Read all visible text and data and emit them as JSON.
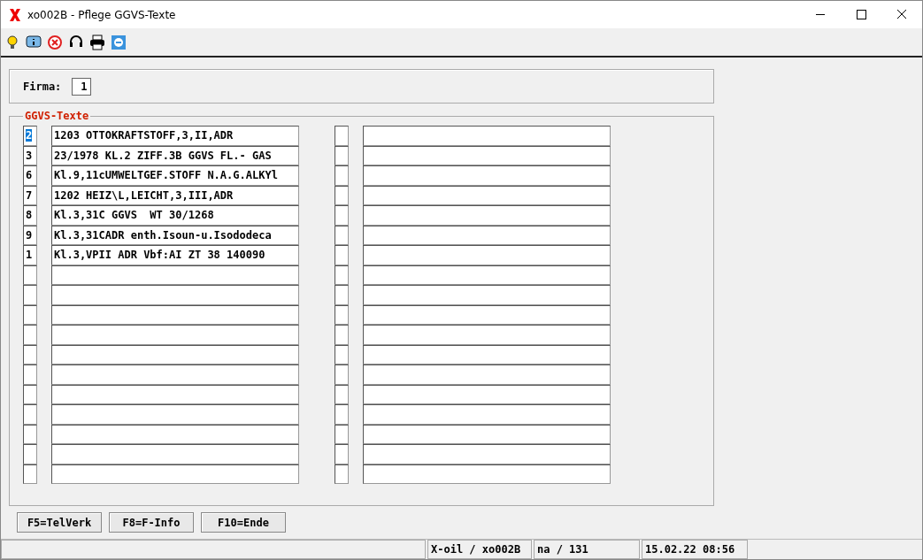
{
  "window": {
    "title": "xo002B - Pflege GGVS-Texte"
  },
  "firma": {
    "label": "Firma:",
    "value": "1"
  },
  "group": {
    "title": "GGVS-Texte"
  },
  "rows": [
    {
      "code": "2",
      "text": "1203 OTTOKRAFTSTOFF,3,II,ADR",
      "selected": true
    },
    {
      "code": "3",
      "text": "23/1978 KL.2 ZIFF.3B GGVS FL.- GAS",
      "selected": false
    },
    {
      "code": "6",
      "text": "Kl.9,11cUMWELTGEF.STOFF N.A.G.ALKYl",
      "selected": false
    },
    {
      "code": "7",
      "text": "1202 HEIZ\\L,LEICHT,3,III,ADR",
      "selected": false
    },
    {
      "code": "8",
      "text": "Kl.3,31C GGVS  WT 30/1268",
      "selected": false
    },
    {
      "code": "9",
      "text": "Kl.3,31CADR enth.Isoun-u.Isododeca",
      "selected": false
    },
    {
      "code": "1",
      "text": "Kl.3,VPII ADR Vbf:AI ZT 38 140090",
      "selected": false
    }
  ],
  "buttons": [
    "F5=TelVerk",
    "F8=F-Info",
    "F10=Ende"
  ],
  "status_bar": [
    "X-oil / xo002B",
    "na / 131",
    "15.02.22 08:56"
  ]
}
